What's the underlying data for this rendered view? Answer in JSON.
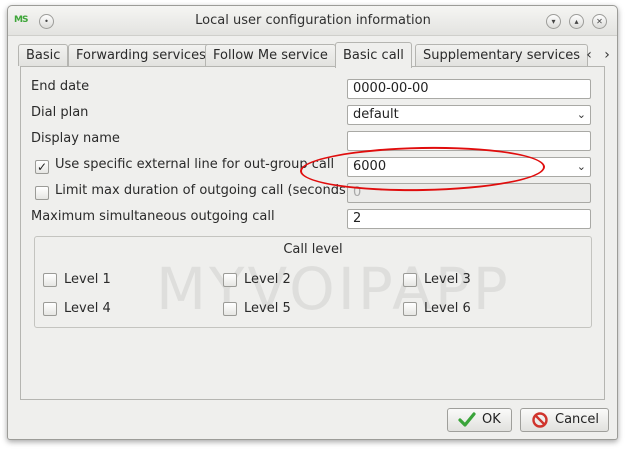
{
  "window": {
    "title": "Local user configuration information",
    "app_icon_text": "MS"
  },
  "tabs": [
    "Basic",
    "Forwarding services",
    "Follow Me service",
    "Basic call",
    "Supplementary services"
  ],
  "active_tab": "Basic call",
  "form": {
    "end_date": {
      "label": "End date",
      "value": "0000-00-00"
    },
    "dial_plan": {
      "label": "Dial plan",
      "value": "default"
    },
    "display_name": {
      "label": "Display name",
      "value": ""
    },
    "external_line": {
      "label": "Use specific external line for out-group call",
      "checked": true,
      "value": "6000"
    },
    "limit_duration": {
      "label": "Limit max duration of outgoing call (seconds)",
      "checked": false,
      "value": "0"
    },
    "max_simultaneous": {
      "label": "Maximum simultaneous outgoing call",
      "value": "2"
    }
  },
  "call_level": {
    "title": "Call level",
    "levels": [
      "Level 1",
      "Level 2",
      "Level 3",
      "Level 4",
      "Level 5",
      "Level 6"
    ]
  },
  "watermark": "MYVOIPAPP",
  "buttons": {
    "ok": "OK",
    "cancel": "Cancel"
  },
  "colors": {
    "annotation": "#e00d0d",
    "ok_check": "#3aa43a",
    "cancel_icon": "#d0342c"
  }
}
